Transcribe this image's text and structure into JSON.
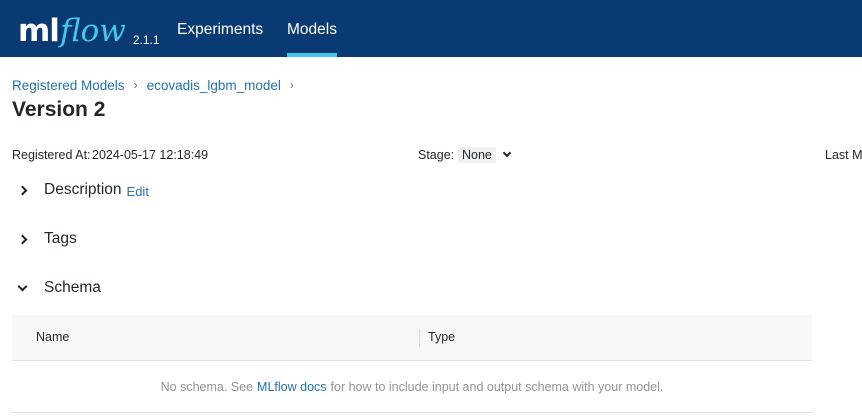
{
  "header": {
    "logo_ml": "ml",
    "logo_flow": "flow",
    "version": "2.1.1",
    "nav": [
      {
        "label": "Experiments",
        "active": false
      },
      {
        "label": "Models",
        "active": true
      }
    ],
    "colors": {
      "background": "#0a3a73",
      "accent": "#43c9ed"
    }
  },
  "breadcrumb": {
    "items": [
      "Registered Models",
      "ecovadis_lgbm_model"
    ]
  },
  "page": {
    "title": "Version 2"
  },
  "meta": {
    "registered_label": "Registered At:",
    "registered_value": "2024-05-17 12:18:49",
    "stage_label": "Stage:",
    "stage_value": "None",
    "last_modified_label": "Last Mo"
  },
  "sections": {
    "description": {
      "title": "Description",
      "edit_label": "Edit",
      "expanded": false
    },
    "tags": {
      "title": "Tags",
      "expanded": false
    },
    "schema": {
      "title": "Schema",
      "expanded": true
    }
  },
  "schema_table": {
    "columns": [
      "Name",
      "Type"
    ],
    "empty_prefix": "No schema. See",
    "empty_link": "MLflow docs",
    "empty_suffix": "for how to include input and output schema with your model."
  }
}
